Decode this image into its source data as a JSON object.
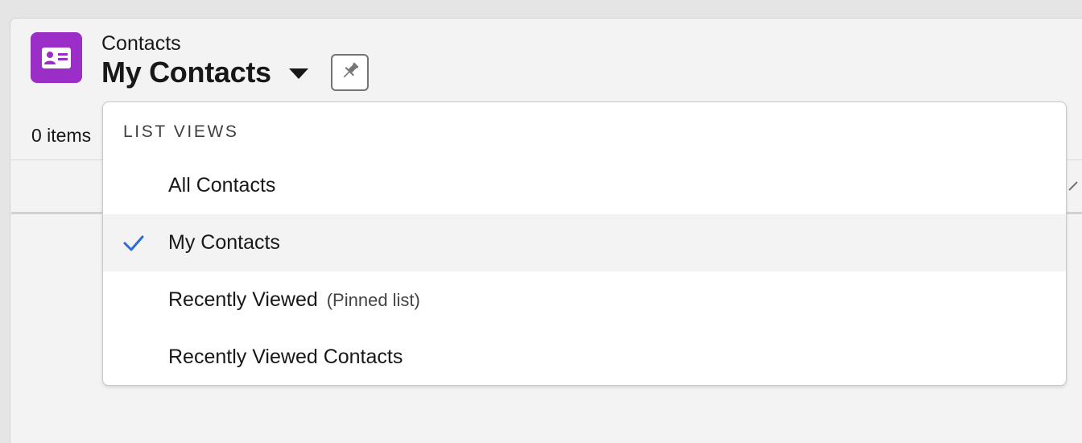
{
  "header": {
    "object_label": "Contacts",
    "view_title": "My Contacts",
    "icon": "contact-card-icon",
    "icon_color": "#9a2ec6",
    "pin_icon": "pin-icon"
  },
  "list": {
    "items_count": "0 items"
  },
  "dropdown": {
    "header": "LIST VIEWS",
    "items": [
      {
        "label": "All Contacts",
        "sub": "",
        "selected": false
      },
      {
        "label": "My Contacts",
        "sub": "",
        "selected": true
      },
      {
        "label": "Recently Viewed",
        "sub": "(Pinned list)",
        "selected": false
      },
      {
        "label": "Recently Viewed Contacts",
        "sub": "",
        "selected": false
      }
    ],
    "check_color": "#2e6bd6",
    "check_icon": "checkmark-icon"
  }
}
